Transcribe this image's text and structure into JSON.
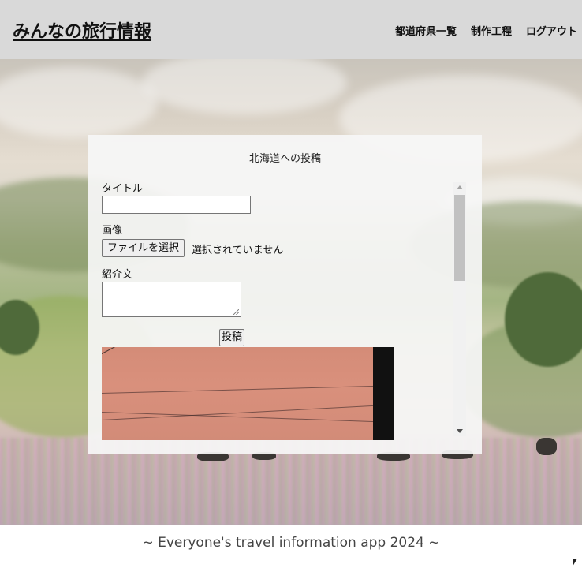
{
  "header": {
    "title": "みんなの旅行情報",
    "nav": [
      {
        "label": "都道府県一覧"
      },
      {
        "label": "制作工程"
      },
      {
        "label": "ログアウト"
      }
    ]
  },
  "form": {
    "heading": "北海道への投稿",
    "title_label": "タイトル",
    "title_value": "",
    "image_label": "画像",
    "file_button_label": "ファイルを選択",
    "file_status": "選択されていません",
    "description_label": "紹介文",
    "description_value": "",
    "submit_label": "投稿"
  },
  "footer": {
    "text": "~ Everyone's travel information app 2024 ~"
  }
}
